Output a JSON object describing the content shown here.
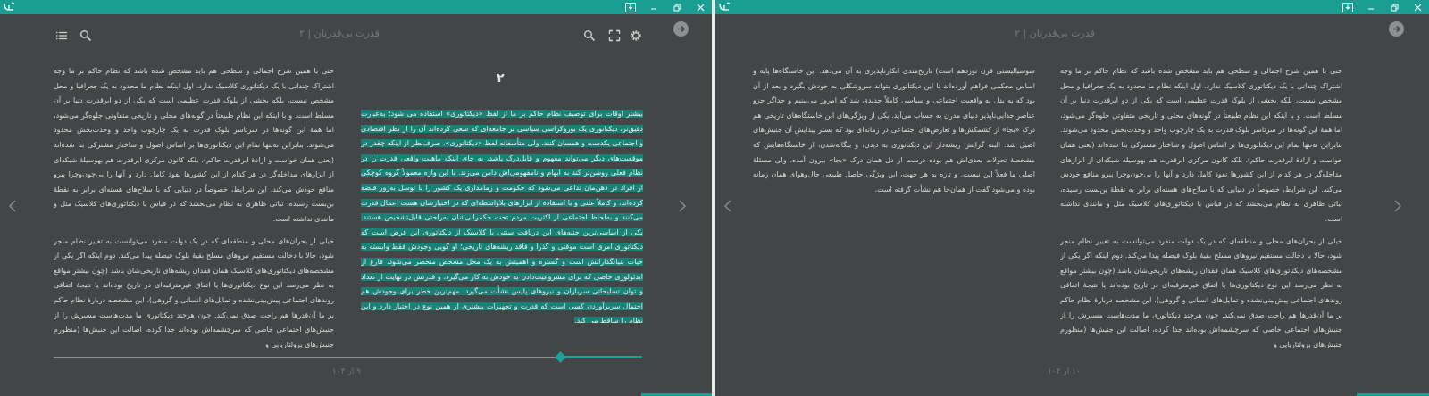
{
  "window_left": {
    "book_title": "قدرت بی‌قدرتان | ۲",
    "page_indicator": "۹ از ۱۰۴",
    "chapter_number": "۲",
    "progress": 0.86,
    "icons": {
      "settings": "gear-icon",
      "fullscreen": "fullscreen-icon",
      "search_right": "search-icon",
      "search_left": "search-icon",
      "toc": "list-icon",
      "forward": "arrow-right-circle-icon"
    }
  },
  "window_right": {
    "book_title": "قدرت بی‌قدرتان | ۲",
    "page_indicator": "۱۰ از ۱۰۴"
  },
  "text": {
    "para_a": "حتی با همین شرح اجمالی و سطحی هم باید مشخص شده باشد که نظام حاکم بر ما وجه اشتراک چندانی با یک دیکتاتوری کلاسیک ندارد. اول اینکه نظام ما محدود به یک جغرافیا و محل مشخص نیست، بلکه بخشی از بلوک قدرت عظیمی است که یکی از دو ابرقدرت دنیا بر آن مسلط است. و با اینکه این نظام طبیعتاً در گونه‌های محلی و تاریخی متفاوتی جلوه‌گر می‌شود، اما همهٔ این گونه‌ها در سرتاسر بلوک قدرت به یک چارچوب واحد و وحدت‌بخش محدود می‌شوند. بنابراین نه‌تنها تمام این دیکتاتوری‌ها بر اساس اصول و ساختار مشترکی بنا شده‌اند (یعنی همان خواست و ارادهٔ ابرقدرت حاکم)، بلکه کانون مرکزی ابرقدرت هم بهوسیلهٔ شبکه‌ای از ابزارهای مداخله‌گر در هر کدام از این کشورها نفوذ کامل دارد و آنها را بی‌چون‌وچرا پیرو منافع خودش می‌کند. این شرایط، خصوصاً در دنیایی که با سلاح‌های هسته‌ای برابر به نقطهٔ بن‌بست رسیده، ثباتی ظاهری به نظام می‌بخشد که در قیاس با دیکتاتوری‌های کلاسیک مثل و مانندی نداشته است.",
    "para_b": "خیلی از بحران‌های محلی و منطقه‌ای که در یک دولت منفرد می‌توانست به تغییر نظام منجر شود، حالا با دخالت مستقیم نیروهای مسلح بقیهٔ بلوک فیصله پیدا می‌کند. دوم اینکه اگر یکی از مشخصه‌های دیکتاتوری‌های کلاسیک همان فقدان ریشه‌های تاریخی‌شان باشد (چون بیشتر مواقع به نظر می‌رسد این نوع دیکتاتوری‌ها یا اتفاق غیرمترقبه‌ای در تاریخ بوده‌اند یا نتیجهٔ اتفاقی روندهای اجتماعی پیش‌بینی‌نشده و تمایل‌های انسانی و گروهی)، این مشخصه دربارهٔ نظام حاکم بر ما آن‌قدرها هم راحت صدق نمی‌کند. چون هرچند دیکتاتوری ما مدت‌هاست مسیرش را از جنبش‌های اجتماعی خاصی که سرچشمه‌اش بوده‌اند جدا کرده، اصالت این جنبش‌ها (منظورم جنبش‌های پرولتاریایی و",
    "para_c": "بیشتر اوقات برای توصیف نظام حاکم بر ما از لفظ «دیکتاتوری» استفاده می شود؛ به‌عبارت دقیق‌تر، دیکتاتوری یک بوروکراسی سیاسی بر جامعه‌ای که سعی کرده‌اند آن را از نظر اقتصادی و اجتماعی یکدست و همسان کنند. ولی متأسفانه لفظ «دیکتاتوری»، صرف‌نظر از اینکه چقدر در موقعیت‌های دیگر می‌تواند مفهوم و قابل‌درک باشد، به جای اینکه ماهیت واقعی قدرت را در نظام فعلی روشن‌تر کند به ابهام و نامفهومی‌اش دامن می‌زند. با این واژه معمولاً گروه کوچکی از افراد در ذهن‌مان تداعی می‌شود که حکومت و زمامداری یک کشور را با توسل به‌زور قبضه کرده‌اند، و کاملاً علنی و با استفاده از ابزارهای بلاواسطه‌ای که در اختیارشان هست اعمال قدرت می‌کنند و به‌لحاظ اجتماعی از اکثریت مردم تحت حکمرانی‌شان به‌راحتی قابل‌تشخیص هستند. یکی از اساسی‌ترین جنبه‌های این دریافت سنتی یا کلاسیک از دیکتاتوری این فرض است که دیکتاتوری امری است موقتی و گذرا و فاقد ریشه‌های تاریخی؛ او گویی وجودش فقط وابسته به حیات بنیانگذارانش است و گستره و اهمیتش به یک محل مشخص منحصر می‌شود، فارغ از ایدئولوژی خاصی که برای مشروعیت‌دادن به خودش به کار می‌گیرد، و قدرتش در نهایت از تعداد و توان تسلیحاتی سربازان و نیروهای پلیس نشأت می‌گیرد. مهم‌ترین خطر برای وجودش هم احتمال سربرآوردن کسی است که قدرت و تجهیزات بیشتری از همین نوع در اختیار دارد و این نظام را ساقط می کند.",
    "para_d": "سوسیالیستی قرن نوزدهم است) تاریخ‌مندی انکارناپذیری به آن می‌دهد. این خاستگاه‌ها پایه و اساس محکمی فراهم آورده‌اند تا این دیکتاتوری بتواند سروشکلی به خودش بگیرد و بعد از آن بود که به بدل به واقعیت اجتماعی و سیاسی کاملاً جدیدی شد که امروز می‌بینیم و جداگر جزو عناصر جدایی‌ناپذیر دنیای مدرن به حساب می‌آید. یکی از ویژگی‌های این خاستگاه‌های تاریخی هم درک «بجا» از کشمکش‌ها و تعارض‌های اجتماعی در زمانه‌ای بود که بستر پیدایش آن جنبش‌های اصیل شد. البته گرایش ریشه‌دار این دیکتاتوری به دیدن، و بیگانه‌شدن، از خاستگاه‌هایش که مشخصهٔ تحولات بعدی‌اش هم بوده درست از دل همان درک «بجا» بیرون آمده، ولی مسئلهٔ اصلی ما فعلاً این نیست. و تازه به هر جهت، این ویژگی حاصل طبیعی حال‌وهوای همان زمانه بوده و می‌شود گفت از همان‌جا هم نشأت گرفته است."
  },
  "colors": {
    "titlebar": "#1a9e93",
    "background": "#444546",
    "highlight": "#1a8177",
    "accent": "#1aa396"
  }
}
